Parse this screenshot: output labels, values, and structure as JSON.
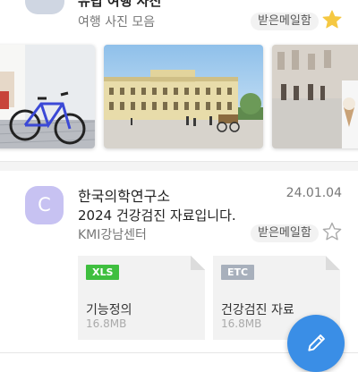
{
  "email_top": {
    "subject": "유럽 여행 사진",
    "sender": "여행 사진 모음",
    "folder_tag": "받은메일함",
    "starred": true
  },
  "photos": [
    {
      "name": "bicycle-photo"
    },
    {
      "name": "palace-photo"
    },
    {
      "name": "street-photo"
    }
  ],
  "email": {
    "avatar_letter": "C",
    "sender": "한국의학연구소",
    "date": "24.01.04",
    "subject": "2024 건강검진 자료입니다.",
    "from": "KMI강남센터",
    "folder_tag": "받은메일함",
    "starred": false
  },
  "attachments": [
    {
      "type": "XLS",
      "name": "기능정의",
      "size": "16.8MB",
      "badge_color": "#3fbf3f"
    },
    {
      "type": "ETC",
      "name": "건강검진 자료",
      "size": "16.8MB",
      "badge_color": "#a8b0bc"
    }
  ],
  "colors": {
    "accent": "#3a8ee6",
    "star_on": "#f5c842",
    "avatar": "#c7c2f2"
  },
  "icons": {
    "compose": "pencil-icon",
    "star_filled": "star-filled-icon",
    "star_outline": "star-outline-icon"
  }
}
